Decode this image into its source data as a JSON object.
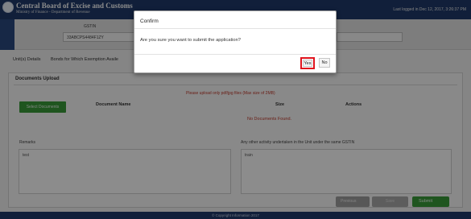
{
  "header": {
    "brand_title": "Central Board of Excise and Customs",
    "brand_subtitle": "Ministry of Finance - Department of Revenue",
    "last_login": "Last logged in Dec 12, 2017, 3:26:37 PM",
    "logo_icon": "cbec-emblem-icon"
  },
  "side_rail": {
    "text": "W\nH\nI"
  },
  "info": {
    "gstin_label": "GSTIN",
    "gstin_value": "33ABCPS4484F1ZY"
  },
  "tabs": [
    {
      "label": "Unit(s) Details"
    },
    {
      "label": "Bonds for Which Exemption Availe"
    }
  ],
  "documents": {
    "title": "Documents Upload",
    "note": "Please upload only pdf/jpg files (Max size of 2MB)",
    "select_button": "Select Documents",
    "col_name": "Document Name",
    "col_size": "Size",
    "col_actions": "Actions",
    "empty_text": "No Documents Found."
  },
  "remarks": {
    "label": "Remarks",
    "value": "test"
  },
  "other_activity": {
    "label": "Any other activity undertaken in the Unit under the same GSTIN",
    "value": "train"
  },
  "footer_buttons": {
    "previous": "Previous",
    "save": "Save",
    "submit": "Submit"
  },
  "footer": {
    "text": "© Copyright Information 2017"
  },
  "modal": {
    "title": "Confirm",
    "message": "Are you sure you want to submit the application?",
    "yes_label": "Yes",
    "no_label": "No"
  },
  "colors": {
    "header_bg": "#1f3a6b",
    "green_button": "#3a9b3a",
    "highlight_red": "#e0141e",
    "error_red": "#c0392b"
  }
}
